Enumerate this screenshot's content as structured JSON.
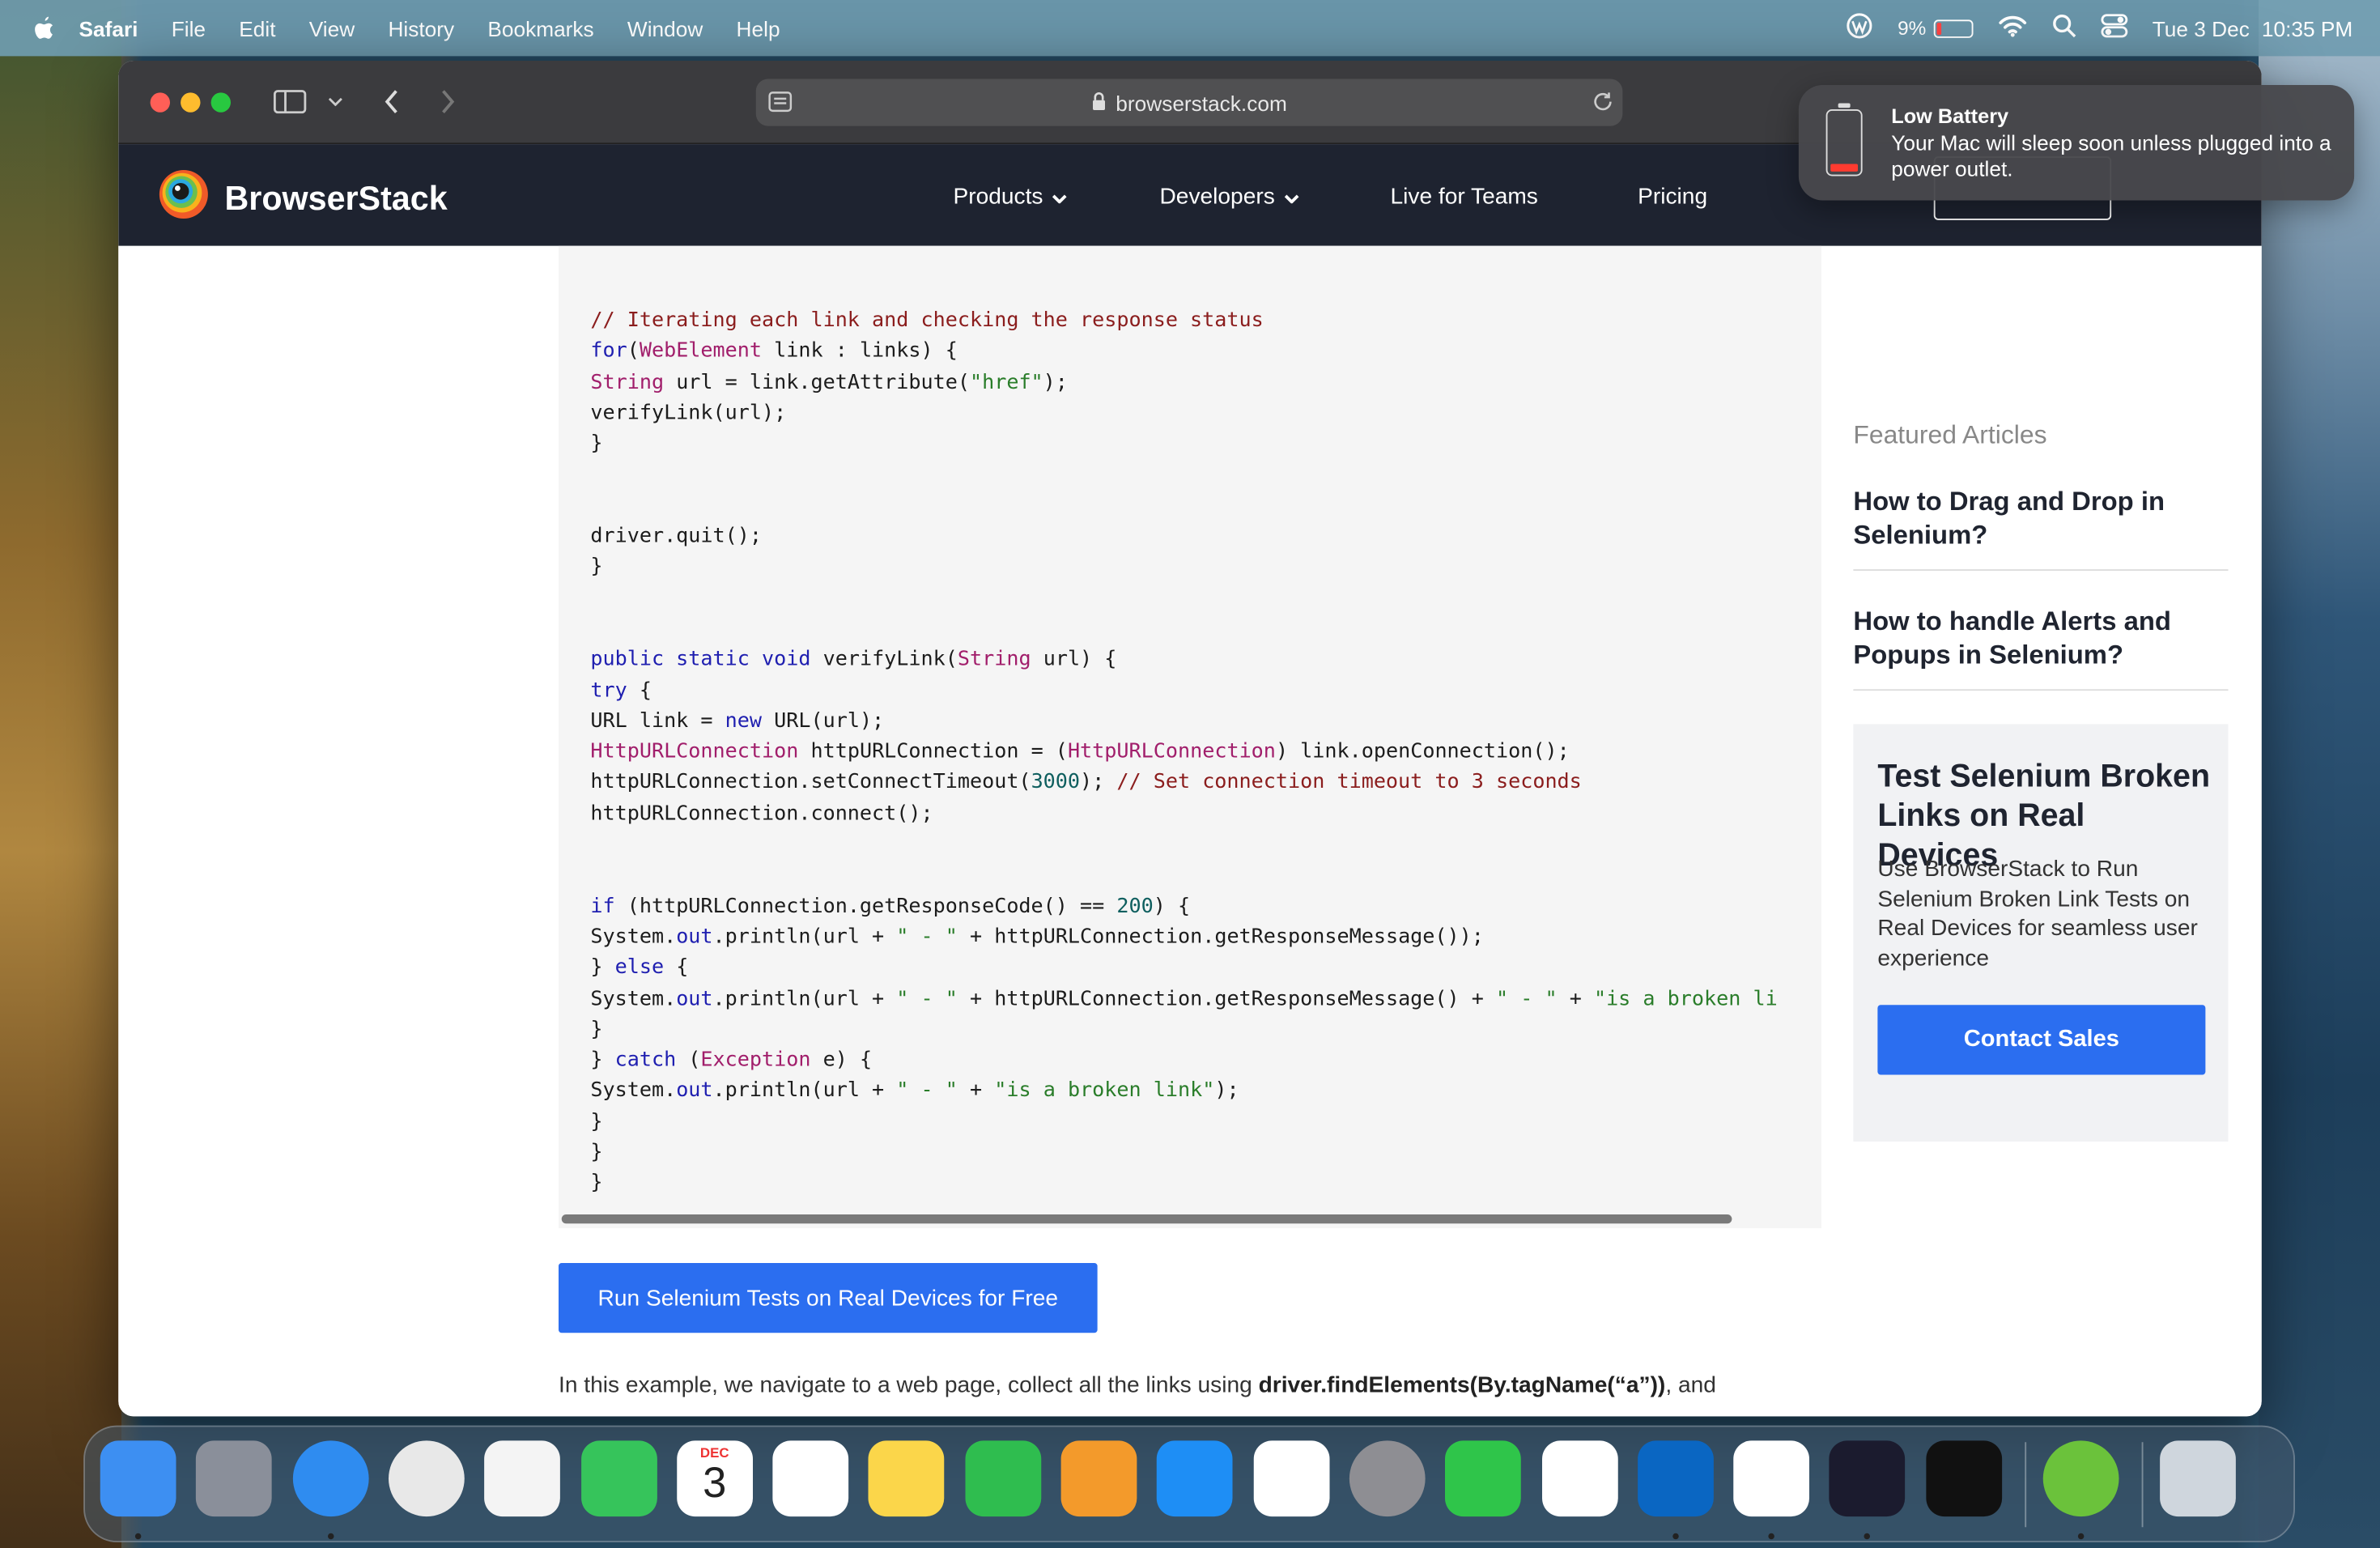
{
  "menubar": {
    "app": "Safari",
    "items": [
      "File",
      "Edit",
      "View",
      "History",
      "Bookmarks",
      "Window",
      "Help"
    ],
    "battery_percent": "9%",
    "date": "Tue 3 Dec",
    "time": "10:35 PM"
  },
  "browser": {
    "url": "browserstack.com"
  },
  "site_nav": {
    "brand": "BrowserStack",
    "items": [
      "Products",
      "Developers",
      "Live for Teams",
      "Pricing"
    ]
  },
  "code": {
    "lines": [
      [
        [
          "cm",
          "// Iterating each link and checking the response status"
        ]
      ],
      [
        [
          "kw",
          "for"
        ],
        [
          "",
          "("
        ],
        [
          "ty",
          "WebElement"
        ],
        [
          "",
          " link : links) {"
        ]
      ],
      [
        [
          "ty",
          "String"
        ],
        [
          "",
          " url = link.getAttribute("
        ],
        [
          "st",
          "\"href\""
        ],
        [
          "",
          ");"
        ]
      ],
      [
        [
          "",
          "verifyLink(url);"
        ]
      ],
      [
        [
          "",
          "}"
        ]
      ],
      [
        [
          "",
          ""
        ]
      ],
      [
        [
          "",
          ""
        ]
      ],
      [
        [
          "",
          "driver.quit();"
        ]
      ],
      [
        [
          "",
          "}"
        ]
      ],
      [
        [
          "",
          ""
        ]
      ],
      [
        [
          "",
          ""
        ]
      ],
      [
        [
          "kw",
          "public static void"
        ],
        [
          "",
          " verifyLink("
        ],
        [
          "ty",
          "String"
        ],
        [
          "",
          " url) {"
        ]
      ],
      [
        [
          "kw",
          "try"
        ],
        [
          "",
          " {"
        ]
      ],
      [
        [
          "",
          "URL link = "
        ],
        [
          "kw",
          "new"
        ],
        [
          "",
          " URL(url);"
        ]
      ],
      [
        [
          "ty",
          "HttpURLConnection"
        ],
        [
          "",
          " httpURLConnection = ("
        ],
        [
          "ty",
          "HttpURLConnection"
        ],
        [
          "",
          ") link.openConnection();"
        ]
      ],
      [
        [
          "",
          "httpURLConnection.setConnectTimeout("
        ],
        [
          "nu",
          "3000"
        ],
        [
          "",
          "); "
        ],
        [
          "cm",
          "// Set connection timeout to 3 seconds"
        ]
      ],
      [
        [
          "",
          "httpURLConnection.connect();"
        ]
      ],
      [
        [
          "",
          ""
        ]
      ],
      [
        [
          "",
          ""
        ]
      ],
      [
        [
          "kw",
          "if"
        ],
        [
          "",
          " (httpURLConnection.getResponseCode() == "
        ],
        [
          "nu",
          "200"
        ],
        [
          "",
          ") {"
        ]
      ],
      [
        [
          "",
          "System."
        ],
        [
          "kw",
          "out"
        ],
        [
          "",
          ".println(url + "
        ],
        [
          "st",
          "\" - \""
        ],
        [
          "",
          " + httpURLConnection.getResponseMessage());"
        ]
      ],
      [
        [
          "",
          "} "
        ],
        [
          "kw",
          "else"
        ],
        [
          "",
          " {"
        ]
      ],
      [
        [
          "",
          "System."
        ],
        [
          "kw",
          "out"
        ],
        [
          "",
          ".println(url + "
        ],
        [
          "st",
          "\" - \""
        ],
        [
          "",
          " + httpURLConnection.getResponseMessage() + "
        ],
        [
          "st",
          "\" - \""
        ],
        [
          "",
          " + "
        ],
        [
          "st",
          "\"is a broken li"
        ]
      ],
      [
        [
          "",
          "}"
        ]
      ],
      [
        [
          "",
          "} "
        ],
        [
          "kw",
          "catch"
        ],
        [
          "",
          " ("
        ],
        [
          "ty",
          "Exception"
        ],
        [
          "",
          " e) {"
        ]
      ],
      [
        [
          "",
          "System."
        ],
        [
          "kw",
          "out"
        ],
        [
          "",
          ".println(url + "
        ],
        [
          "st",
          "\" - \""
        ],
        [
          "",
          " + "
        ],
        [
          "st",
          "\"is a broken link\""
        ],
        [
          "",
          ");"
        ]
      ],
      [
        [
          "",
          "}"
        ]
      ],
      [
        [
          "",
          "}"
        ]
      ],
      [
        [
          "",
          "}"
        ]
      ]
    ]
  },
  "cta_label": "Run Selenium Tests on Real Devices for Free",
  "paragraph": {
    "before": "In this example, we navigate to a web page, collect all the links using ",
    "bold": "driver.findElements(By.tagName(“a”))",
    "after": ", and"
  },
  "sidebar": {
    "heading": "Featured Articles",
    "articles": [
      "How to Drag and Drop in Selenium?",
      "How to handle Alerts and Popups in Selenium?"
    ],
    "card": {
      "title": "Test Selenium Broken Links on Real Devices",
      "body": "Use BrowserStack to Run Selenium Broken Link Tests on Real Devices for seamless user experience",
      "button": "Contact Sales"
    }
  },
  "notification": {
    "title": "Low Battery",
    "body": "Your Mac will sleep soon unless plugged into a power outlet."
  },
  "dock": {
    "calendar_month": "DEC",
    "calendar_day": "3",
    "apps": [
      {
        "name": "finder-icon",
        "color": "#3d8ff2",
        "dot": true
      },
      {
        "name": "launchpad-icon",
        "color": "#8a8f9a",
        "dot": false
      },
      {
        "name": "safari-icon",
        "color": "#2f8cf0",
        "dot": true
      },
      {
        "name": "chrome-icon",
        "color": "#e8e8e8",
        "dot": false
      },
      {
        "name": "photos-icon",
        "color": "#f4f4f4",
        "dot": false
      },
      {
        "name": "facetime-icon",
        "color": "#36c45b",
        "dot": false
      },
      {
        "name": "calendar-icon",
        "color": "#ffffff",
        "dot": false
      },
      {
        "name": "reminders-icon",
        "color": "#ffffff",
        "dot": false
      },
      {
        "name": "notes-icon",
        "color": "#fbd64a",
        "dot": false
      },
      {
        "name": "numbers-icon",
        "color": "#2fbd4f",
        "dot": false
      },
      {
        "name": "pages-icon",
        "color": "#f39a2b",
        "dot": false
      },
      {
        "name": "app-store-icon",
        "color": "#1e8ef5",
        "dot": false
      },
      {
        "name": "visual-studio-icon",
        "color": "#ffffff",
        "dot": false
      },
      {
        "name": "system-settings-icon",
        "color": "#8e8e93",
        "dot": false
      },
      {
        "name": "whatsapp-icon",
        "color": "#2fc54a",
        "dot": false
      },
      {
        "name": "youtube-icon",
        "color": "#ffffff",
        "dot": false
      },
      {
        "name": "linkedin-icon",
        "color": "#0a66c2",
        "dot": true
      },
      {
        "name": "gmail-icon",
        "color": "#ffffff",
        "dot": true
      },
      {
        "name": "intellij-icon",
        "color": "#1b1b2e",
        "dot": true
      },
      {
        "name": "git-client-icon",
        "color": "#111111",
        "dot": false
      },
      {
        "name": "utorrent-icon",
        "color": "#6bc23b",
        "dot": true
      },
      {
        "name": "trash-icon",
        "color": "#cfd6dd",
        "dot": false
      }
    ]
  },
  "colors": {
    "accent": "#2b6ef0",
    "nav_bg": "#1e2330",
    "code_comment": "#8b1d1d",
    "code_keyword": "#1f1fb0"
  }
}
